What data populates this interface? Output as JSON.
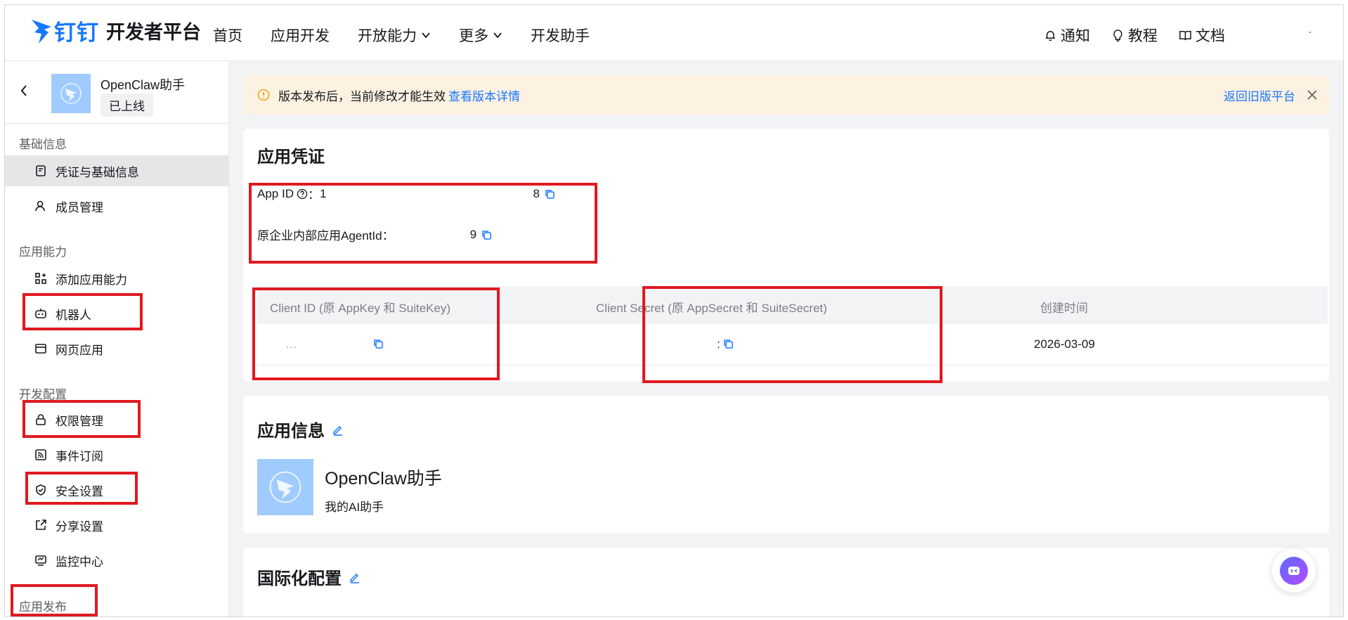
{
  "header": {
    "logo_dd": "钉钉",
    "logo_text": "开发者平台",
    "nav": [
      "首页",
      "应用开发",
      "开放能力",
      "更多",
      "开发助手"
    ],
    "right": [
      "通知",
      "教程",
      "文档"
    ]
  },
  "sidebar": {
    "app_name": "OpenClaw助手",
    "app_status": "已上线",
    "sections": {
      "basic": "基础信息",
      "capability": "应用能力",
      "dev": "开发配置",
      "publish": "应用发布"
    },
    "items": {
      "credentials": "凭证与基础信息",
      "members": "成员管理",
      "add_capability": "添加应用能力",
      "robot": "机器人",
      "webapp": "网页应用",
      "permissions": "权限管理",
      "events": "事件订阅",
      "security": "安全设置",
      "share": "分享设置",
      "monitor": "监控中心"
    }
  },
  "alert": {
    "text": "版本发布后，当前修改才能生效",
    "link": "查看版本详情",
    "back_old": "返回旧版平台"
  },
  "credentials": {
    "title": "应用凭证",
    "app_id_label": "App ID",
    "app_id_sep": "：",
    "app_id_start": "1",
    "app_id_end": "8",
    "agent_label": "原企业内部应用AgentId：",
    "agent_value": "9",
    "col_client_id": "Client ID (原 AppKey 和 SuiteKey)",
    "col_client_secret": "Client Secret (原 AppSecret 和 SuiteSecret)",
    "col_created": "创建时间",
    "client_id_value": "…",
    "client_secret_value": ":",
    "created_value": "2026-03-09"
  },
  "app_info": {
    "title": "应用信息",
    "name": "OpenClaw助手",
    "desc": "我的AI助手"
  },
  "i18n": {
    "title": "国际化配置"
  },
  "colors": {
    "accent": "#1677ff",
    "highlight": "#e0191f",
    "alert_bg": "#fdf1e1"
  }
}
